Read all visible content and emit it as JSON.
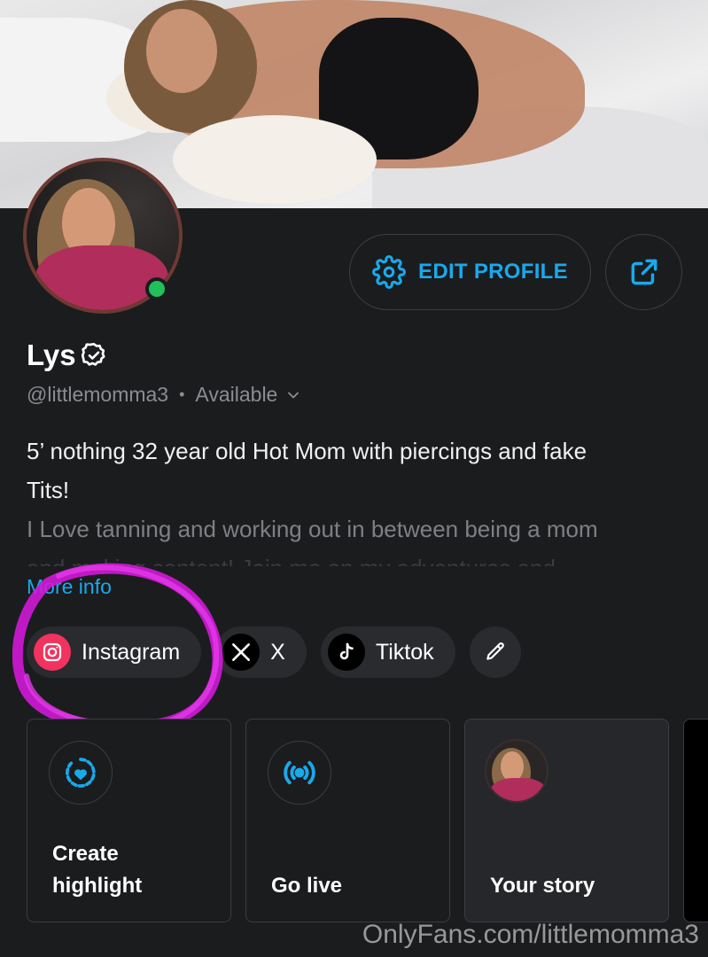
{
  "profile": {
    "name": "Lys",
    "handle": "@littlemomma3",
    "status": "Available",
    "verified_icon": "verified-badge-icon",
    "online": true
  },
  "actions": {
    "edit_profile_label": "EDIT PROFILE",
    "edit_icon": "gear-icon",
    "share_icon": "share-icon"
  },
  "bio": {
    "line1": "5’ nothing 32 year old Hot Mom with piercings and fake",
    "line2": "Tits!",
    "line3": "I Love tanning and working out in between being a mom",
    "line4": "and making content! Join me on my adventures and",
    "more_info": "More info"
  },
  "socials": [
    {
      "label": "Instagram",
      "icon": "instagram-icon",
      "color": "#f2335f"
    },
    {
      "label": "X",
      "icon": "x-icon",
      "color": "#000000"
    },
    {
      "label": "Tiktok",
      "icon": "tiktok-icon",
      "color": "#000000"
    }
  ],
  "cards": {
    "create_highlight": "Create\nhighlight",
    "go_live": "Go live",
    "your_story": "Your story"
  },
  "watermark": "OnlyFans.com/littlemomma3",
  "colors": {
    "accent": "#19a9ec",
    "background": "#1b1c1e",
    "online": "#20c05c",
    "annotation": "#d11ad8"
  }
}
